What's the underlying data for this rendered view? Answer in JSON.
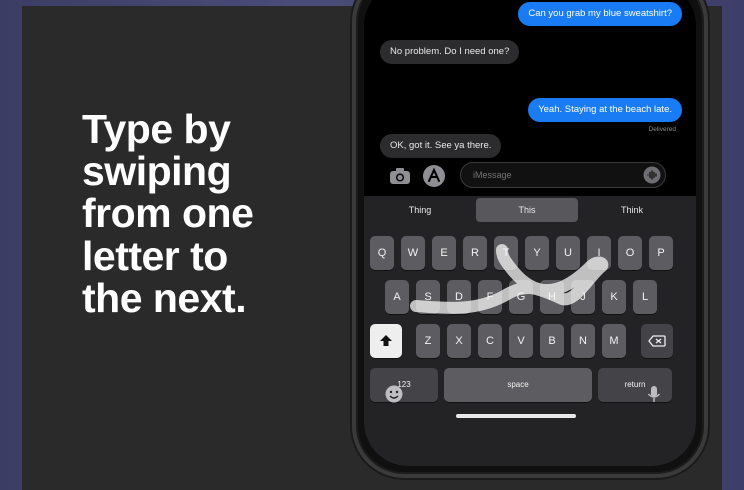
{
  "headline": {
    "lines": [
      "Type by",
      "swiping",
      "from one",
      "letter to",
      "the next."
    ]
  },
  "messages": {
    "items": [
      {
        "text": "Can you grab my blue sweatshirt?",
        "direction": "outgoing"
      },
      {
        "text": "No problem. Do I need one?",
        "direction": "incoming"
      },
      {
        "text": "Yeah. Staying at the beach late.",
        "direction": "outgoing"
      },
      {
        "text": "OK, got it. See ya there.",
        "direction": "incoming"
      }
    ],
    "delivered_label": "Delivered"
  },
  "input": {
    "placeholder": "iMessage"
  },
  "suggestions": [
    "Thing",
    "This",
    "Think"
  ],
  "keyboard": {
    "row1": [
      "Q",
      "W",
      "E",
      "R",
      "T",
      "Y",
      "U",
      "I",
      "O",
      "P"
    ],
    "row2": [
      "A",
      "S",
      "D",
      "F",
      "G",
      "H",
      "J",
      "K",
      "L"
    ],
    "row3": [
      "Z",
      "X",
      "C",
      "V",
      "B",
      "N",
      "M"
    ],
    "numbers_label": "123",
    "space_label": "space",
    "return_label": "return"
  },
  "colors": {
    "outgoing_bubble": "#1a7cf5",
    "incoming_bubble": "#2c2c2e",
    "page_background": "#2a2a2a",
    "key": "#5d5d61"
  },
  "icons": {
    "camera": "camera-icon",
    "apps": "app-store-icon",
    "send": "audio-icon",
    "shift": "shift-icon",
    "delete": "delete-icon",
    "emoji": "emoji-icon",
    "dictation": "microphone-icon"
  }
}
